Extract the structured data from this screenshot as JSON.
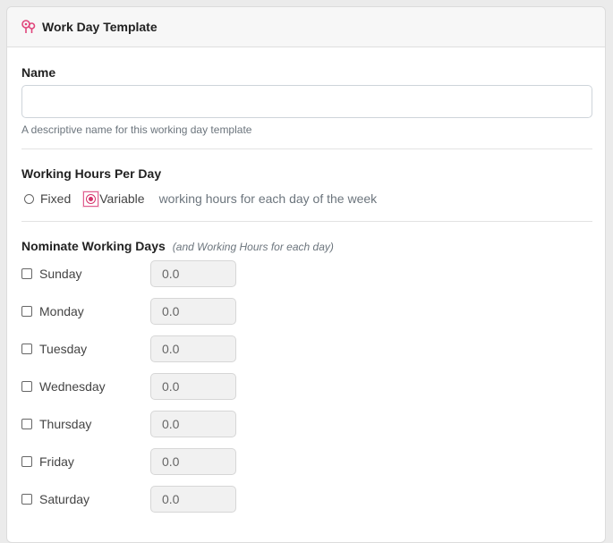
{
  "header": {
    "title": "Work Day Template",
    "icon": "map-pins-icon",
    "accent": "#e0457b"
  },
  "name_field": {
    "label": "Name",
    "value": "",
    "placeholder": "",
    "help": "A descriptive name for this working day template"
  },
  "hours_mode": {
    "label": "Working Hours Per Day",
    "options": [
      {
        "label": "Fixed",
        "checked": false
      },
      {
        "label": "Variable",
        "checked": true
      }
    ],
    "description": "working hours for each day of the week"
  },
  "working_days": {
    "label": "Nominate Working Days",
    "note": "(and Working Hours for each day)",
    "days": [
      {
        "name": "Sunday",
        "checked": false,
        "hours": "0.0"
      },
      {
        "name": "Monday",
        "checked": false,
        "hours": "0.0"
      },
      {
        "name": "Tuesday",
        "checked": false,
        "hours": "0.0"
      },
      {
        "name": "Wednesday",
        "checked": false,
        "hours": "0.0"
      },
      {
        "name": "Thursday",
        "checked": false,
        "hours": "0.0"
      },
      {
        "name": "Friday",
        "checked": false,
        "hours": "0.0"
      },
      {
        "name": "Saturday",
        "checked": false,
        "hours": "0.0"
      }
    ]
  }
}
